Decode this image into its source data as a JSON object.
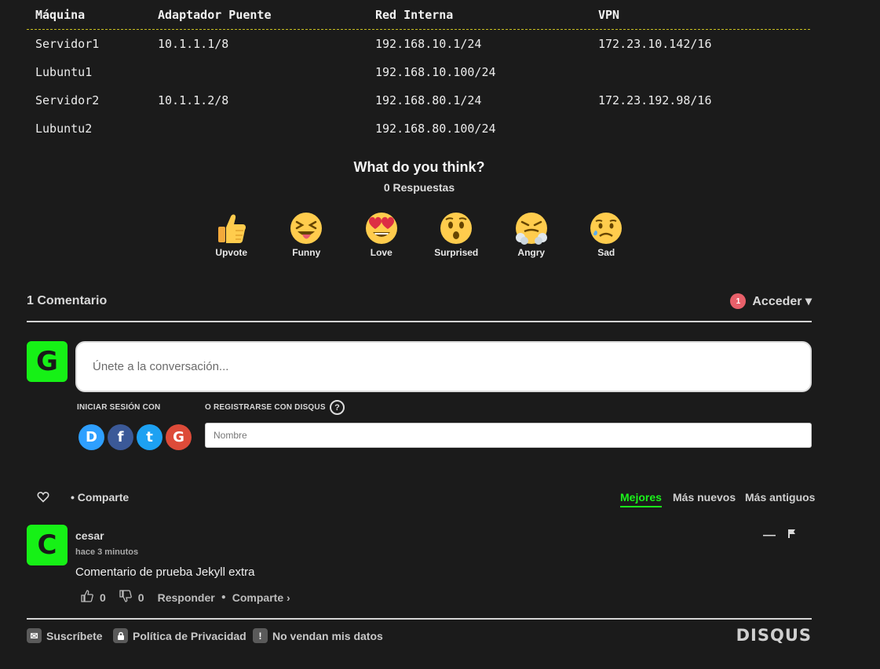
{
  "table": {
    "headers": [
      "Máquina",
      "Adaptador Puente",
      "Red Interna",
      "VPN"
    ],
    "rows": [
      [
        "Servidor1",
        "10.1.1.1/8",
        "192.168.10.1/24",
        "172.23.10.142/16"
      ],
      [
        "Lubuntu1",
        "",
        "192.168.10.100/24",
        ""
      ],
      [
        "Servidor2",
        "10.1.1.2/8",
        "192.168.80.1/24",
        "172.23.192.98/16"
      ],
      [
        "Lubuntu2",
        "",
        "192.168.80.100/24",
        ""
      ]
    ]
  },
  "reactions": {
    "title": "What do you think?",
    "count_label": "0 Respuestas",
    "items": [
      {
        "label": "Upvote",
        "icon": "thumbs-up-emoji"
      },
      {
        "label": "Funny",
        "icon": "squinting-tongue-emoji"
      },
      {
        "label": "Love",
        "icon": "heart-eyes-emoji"
      },
      {
        "label": "Surprised",
        "icon": "hushed-emoji"
      },
      {
        "label": "Angry",
        "icon": "steam-nose-emoji"
      },
      {
        "label": "Sad",
        "icon": "sad-sweat-emoji"
      }
    ]
  },
  "comments": {
    "count_label": "1 Comentario",
    "notifications": "1",
    "login_label": "Acceder ▾",
    "user_avatar_letter": "G",
    "input_placeholder": "Únete a la conversación...",
    "signin_label": "INICIAR SESIÓN CON",
    "register_label": "O REGISTRARSE CON DISQUS",
    "help_icon_text": "?",
    "name_placeholder": "Nombre",
    "social": [
      {
        "name": "disqus",
        "letter": "D",
        "color": "#2e9fff"
      },
      {
        "name": "facebook",
        "letter": "f",
        "color": "#3b5998"
      },
      {
        "name": "twitter",
        "letter": "t",
        "color": "#1da1f2"
      },
      {
        "name": "google",
        "letter": "G",
        "color": "#dd4b39"
      }
    ],
    "share_label": "Comparte",
    "sort": {
      "best": "Mejores",
      "newest": "Más nuevos",
      "oldest": "Más antiguos"
    },
    "list": [
      {
        "avatar_letter": "C",
        "author": "cesar",
        "time": "hace 3 minutos",
        "text": "Comentario de prueba Jekyll extra",
        "upvotes": "0",
        "downvotes": "0",
        "reply_label": "Responder",
        "share_label": "Comparte ›"
      }
    ]
  },
  "footer": {
    "subscribe": "Suscríbete",
    "privacy": "Política de Privacidad",
    "no_sell": "No vendan mis datos",
    "brand": "DISQUS"
  },
  "colors": {
    "accent": "#1bf21b",
    "background": "#1b1b1b",
    "badge": "#e8606a",
    "table_divider": "#c9c020"
  }
}
